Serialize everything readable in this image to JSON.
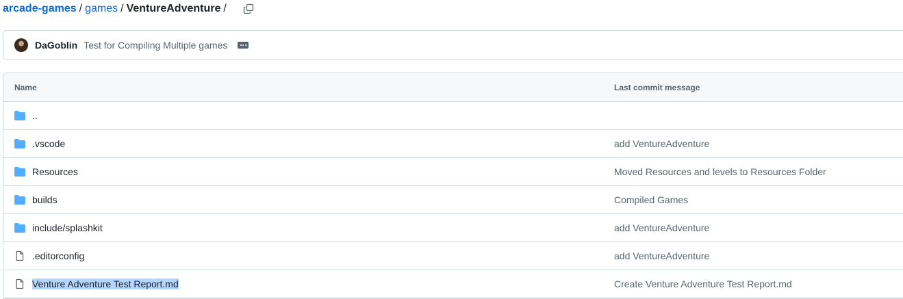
{
  "breadcrumb": {
    "repo": "arcade-games",
    "folder": "games",
    "current": "VentureAdventure",
    "separator": "/",
    "trailing_separator": "/"
  },
  "latest_commit": {
    "author": "DaGoblin",
    "message": "Test for Compiling Multiple games"
  },
  "table": {
    "headers": {
      "name": "Name",
      "last_commit_message": "Last commit message"
    },
    "rows": [
      {
        "type": "folder",
        "name": "..",
        "message": ""
      },
      {
        "type": "folder",
        "name": ".vscode",
        "message": "add VentureAdventure"
      },
      {
        "type": "folder",
        "name": "Resources",
        "message": "Moved Resources and levels to Resources Folder"
      },
      {
        "type": "folder",
        "name": "builds",
        "message": "Compiled Games"
      },
      {
        "type": "folder",
        "name": "include/splashkit",
        "message": "add VentureAdventure"
      },
      {
        "type": "file",
        "name": ".editorconfig",
        "message": "add VentureAdventure"
      },
      {
        "type": "file",
        "name": "Venture Adventure Test Report.md",
        "message": "Create Venture Adventure Test Report.md"
      }
    ]
  },
  "icons": {
    "folder": "folder-icon",
    "file": "file-icon",
    "copy": "copy-icon",
    "ellipsis": "ellipsis-icon"
  },
  "colors": {
    "link": "#0969da",
    "folder_icon": "#54aeff",
    "file_icon": "#59636e",
    "selection": "#b4d5fe"
  }
}
